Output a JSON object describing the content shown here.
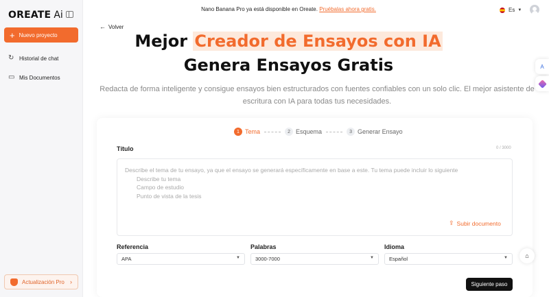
{
  "brand": {
    "name": "OREATE",
    "suffix": "Ai",
    "accent": "#f26b2d"
  },
  "sidebar": {
    "new_project": "Nuevo proyecto",
    "items": [
      {
        "label": "Historial de chat",
        "icon": "history-icon"
      },
      {
        "label": "Mis Documentos",
        "icon": "folder-icon"
      }
    ],
    "upgrade": "Actualización Pro"
  },
  "banner": {
    "text": "Nano Banana Pro ya está disponible en Oreate.",
    "link": "Pruébalas ahora gratis."
  },
  "lang": {
    "code": "Es"
  },
  "back": "Volver",
  "hero": {
    "title_prefix": "Mejor",
    "title_highlight": "Creador de Ensayos con IA",
    "title2": "Genera Ensayos Gratis",
    "subtitle": "Redacta de forma inteligente y consigue ensayos bien estructurados con fuentes confiables con un solo clic. El mejor asistente de escritura con IA para todas tus necesidades."
  },
  "steps": [
    {
      "num": "1",
      "label": "Tema",
      "active": true
    },
    {
      "num": "2",
      "label": "Esquema",
      "active": false
    },
    {
      "num": "3",
      "label": "Generar Ensayo",
      "active": false
    }
  ],
  "form": {
    "title_label": "Título",
    "counter": "0 / 3000",
    "placeholder": "Describe el tema de tu ensayo, ya que el ensayo se generará específicamente en base a este. Tu tema puede incluir lo siguiente",
    "hints": [
      "Describe tu tema",
      "Campo de estudio",
      "Punto de vista de la tesis"
    ],
    "upload": "Subir documento",
    "reference_label": "Referencia",
    "reference_value": "APA",
    "words_label": "Palabras",
    "words_value": "3000-7000",
    "language_label": "Idioma",
    "language_value": "Español",
    "next": "Siguiente paso"
  }
}
